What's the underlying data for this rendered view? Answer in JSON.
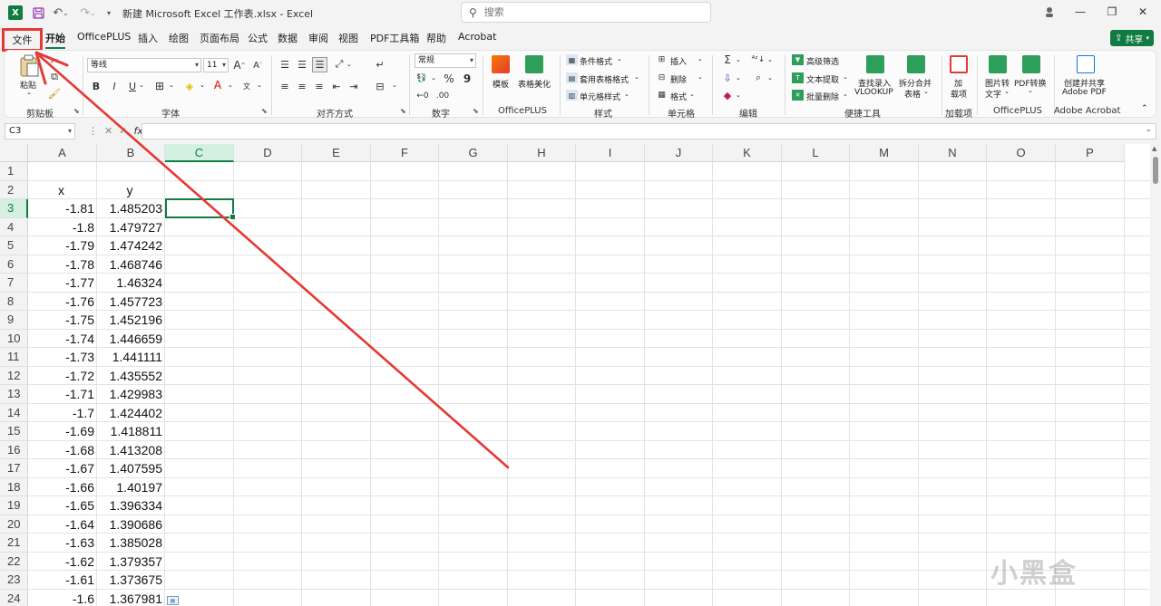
{
  "window": {
    "title": "新建 Microsoft Excel 工作表.xlsx  -  Excel",
    "search_placeholder": "搜索",
    "icons": [
      "excel-logo-icon",
      "save-icon",
      "undo-icon",
      "redo-icon",
      "customize-qat-icon",
      "search-icon",
      "copilot-avatar-icon",
      "minimize-icon",
      "restore-icon",
      "close-icon"
    ]
  },
  "tabs": {
    "file": "文件",
    "items": [
      "开始",
      "OfficePLUS",
      "插入",
      "绘图",
      "页面布局",
      "公式",
      "数据",
      "审阅",
      "视图",
      "PDF工具箱",
      "帮助",
      "Acrobat"
    ],
    "active": "开始",
    "share": "共享"
  },
  "ribbon": {
    "clipboard": {
      "label": "剪贴板",
      "paste": "粘贴"
    },
    "font": {
      "label": "字体",
      "name": "等线",
      "size": "11",
      "buttons": [
        "B",
        "I",
        "U"
      ]
    },
    "alignment": {
      "label": "对齐方式"
    },
    "number": {
      "label": "数字",
      "format": "常规",
      "symbols": [
        "%",
        "9"
      ]
    },
    "officeplus1": {
      "label": "OfficePLUS",
      "templates": "模板",
      "beautify": "表格美化"
    },
    "styles": {
      "label": "样式",
      "items": [
        "条件格式",
        "套用表格格式",
        "单元格样式"
      ]
    },
    "cells": {
      "label": "单元格",
      "items": [
        "插入",
        "删除",
        "格式"
      ]
    },
    "editing": {
      "label": "编辑"
    },
    "quick_tools": {
      "label": "便捷工具",
      "items": [
        "高级筛选",
        "文本提取",
        "批量删除"
      ],
      "vlookup_line1": "查找录入",
      "vlookup_line2": "VLOOKUP",
      "split_line1": "拆分合并",
      "split_line2": "表格"
    },
    "addins": {
      "label": "加载项",
      "line1": "加",
      "line2": "载项"
    },
    "officeplus2": {
      "label": "OfficePLUS",
      "img_line1": "图片转",
      "img_line2": "文字",
      "pdf": "PDF转换"
    },
    "acrobat": {
      "label": "Adobe Acrobat",
      "line1": "创建并共享",
      "line2": "Adobe PDF"
    }
  },
  "formula_bar": {
    "name_box": "C3",
    "fx": "fx",
    "value": ""
  },
  "sheet": {
    "columns": [
      "A",
      "B",
      "C",
      "D",
      "E",
      "F",
      "G",
      "H",
      "I",
      "J",
      "K",
      "L",
      "M",
      "N",
      "O",
      "P"
    ],
    "selected_column": "C",
    "selected_row": 3,
    "rows": [
      1,
      2,
      3,
      4,
      5,
      6,
      7,
      8,
      9,
      10,
      11,
      12,
      13,
      14,
      15,
      16,
      17,
      18,
      19,
      20,
      21,
      22,
      23,
      24
    ],
    "header_row": {
      "A": "x",
      "B": "y"
    },
    "data": [
      [
        "-1.81",
        "1.485203"
      ],
      [
        "-1.8",
        "1.479727"
      ],
      [
        "-1.79",
        "1.474242"
      ],
      [
        "-1.78",
        "1.468746"
      ],
      [
        "-1.77",
        "1.46324"
      ],
      [
        "-1.76",
        "1.457723"
      ],
      [
        "-1.75",
        "1.452196"
      ],
      [
        "-1.74",
        "1.446659"
      ],
      [
        "-1.73",
        "1.441111"
      ],
      [
        "-1.72",
        "1.435552"
      ],
      [
        "-1.71",
        "1.429983"
      ],
      [
        "-1.7",
        "1.424402"
      ],
      [
        "-1.69",
        "1.418811"
      ],
      [
        "-1.68",
        "1.413208"
      ],
      [
        "-1.67",
        "1.407595"
      ],
      [
        "-1.66",
        "1.40197"
      ],
      [
        "-1.65",
        "1.396334"
      ],
      [
        "-1.64",
        "1.390686"
      ],
      [
        "-1.63",
        "1.385028"
      ],
      [
        "-1.62",
        "1.379357"
      ],
      [
        "-1.61",
        "1.373675"
      ],
      [
        "-1.6",
        "1.367981"
      ]
    ]
  },
  "annotation": {
    "highlight_color": "#e53935",
    "target": "文件"
  },
  "watermark": "小黑盒"
}
